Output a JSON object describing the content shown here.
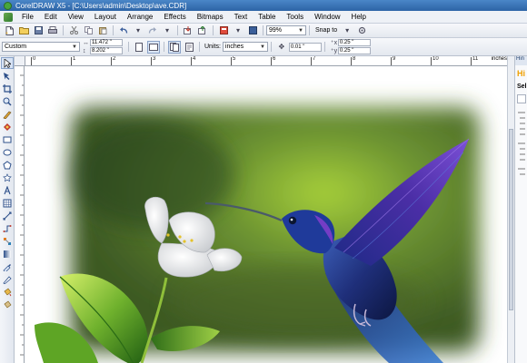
{
  "window": {
    "title": "CorelDRAW X5 - [C:\\Users\\admin\\Desktop\\ave.CDR]"
  },
  "menu": [
    "File",
    "Edit",
    "View",
    "Layout",
    "Arrange",
    "Effects",
    "Bitmaps",
    "Text",
    "Table",
    "Tools",
    "Window",
    "Help"
  ],
  "toolbar": {
    "zoom": "99%",
    "snap": "Snap to"
  },
  "propbar": {
    "preset": "Custom",
    "width": "11.472 \"",
    "height": "8.202 \"",
    "units_label": "Units:",
    "units": "inches",
    "nudge": "0.01 \"",
    "dup_x": "0.25 \"",
    "dup_y": "0.25 \""
  },
  "ruler": {
    "h_ticks": [
      "0",
      "1",
      "2",
      "3",
      "4",
      "5",
      "6",
      "7",
      "8",
      "9",
      "10",
      "11"
    ],
    "units": "inches"
  },
  "docker": {
    "tab": "Hin",
    "title": "Hi",
    "section": "Sel"
  }
}
